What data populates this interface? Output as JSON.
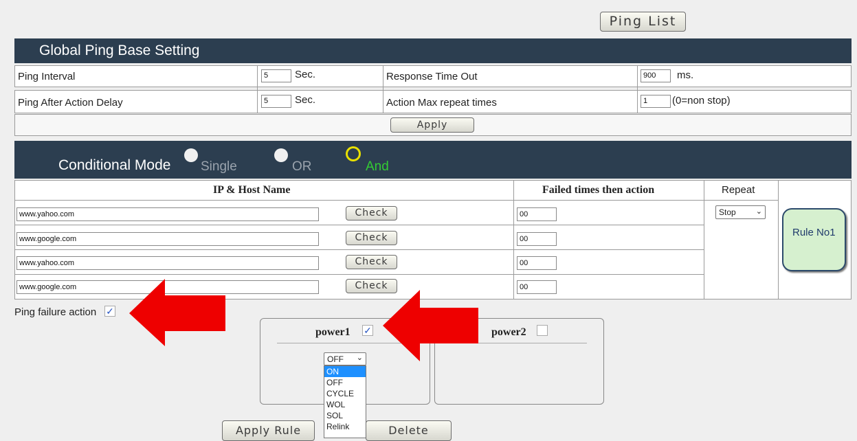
{
  "ping_list_button": "Ping List",
  "global": {
    "title": "Global Ping Base Setting",
    "ping_interval_label": "Ping Interval",
    "ping_interval_value": "5",
    "ping_interval_unit": "Sec.",
    "response_timeout_label": "Response Time Out",
    "response_timeout_value": "900",
    "response_timeout_unit": "ms.",
    "after_delay_label": "Ping After Action Delay",
    "after_delay_value": "5",
    "after_delay_unit": "Sec.",
    "max_repeat_label": "Action Max repeat times",
    "max_repeat_value": "1",
    "max_repeat_note": "(0=non stop)",
    "apply_label": "Apply"
  },
  "conditional": {
    "title": "Conditional Mode",
    "modes": [
      {
        "label": "Single",
        "selected": false
      },
      {
        "label": "OR",
        "selected": false
      },
      {
        "label": "And",
        "selected": true
      }
    ],
    "col_ip": "IP & Host Name",
    "col_failed": "Failed times then action",
    "col_repeat": "Repeat",
    "check_label": "Check",
    "hosts": [
      {
        "host": "www.yahoo.com",
        "failed": "00"
      },
      {
        "host": "www.google.com",
        "failed": "00"
      },
      {
        "host": "www.yahoo.com",
        "failed": "00"
      },
      {
        "host": "www.google.com",
        "failed": "00"
      }
    ],
    "repeat_value": "Stop",
    "rule_label": "Rule No1"
  },
  "failure": {
    "label": "Ping failure action",
    "checked": true,
    "check_mark": "✓"
  },
  "power1": {
    "label": "power1",
    "checked": true,
    "selected": "OFF",
    "options": [
      "ON",
      "OFF",
      "CYCLE",
      "WOL",
      "SOL",
      "Relink"
    ],
    "highlighted": "ON"
  },
  "power2": {
    "label": "power2",
    "checked": false
  },
  "apply_rule_label": "Apply Rule",
  "delete_label": "Delete",
  "colors": {
    "header_bg": "#2c3e50",
    "and_green": "#33cc33",
    "radio_ring_yellow": "#e8e000",
    "rule_bg": "#d6f0cf",
    "arrow_red": "#ee0000",
    "dropdown_highlight": "#1e90ff"
  }
}
